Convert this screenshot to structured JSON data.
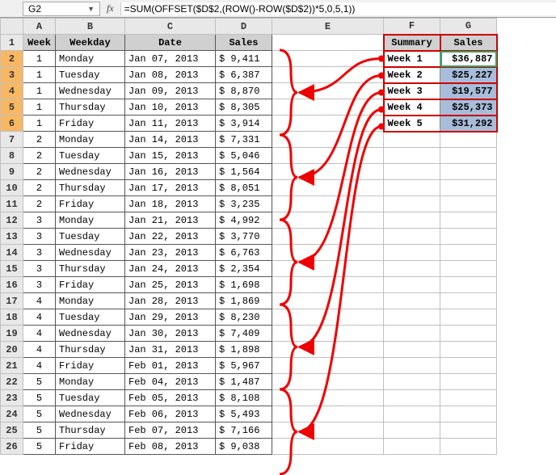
{
  "formula_bar": {
    "cell_ref": "G2",
    "fx_label": "fx",
    "formula": "=SUM(OFFSET($D$2,(ROW()-ROW($D$2))*5,0,5,1))"
  },
  "columns": [
    "A",
    "B",
    "C",
    "D",
    "E",
    "F",
    "G"
  ],
  "main_headers": {
    "A": "Week",
    "B": "Weekday",
    "C": "Date",
    "D": "Sales"
  },
  "summary_headers": {
    "F": "Summary",
    "G": "Sales"
  },
  "rows": [
    {
      "n": 2,
      "wk": "1",
      "wd": "Monday",
      "dt": "Jan 07, 2013",
      "sl": "$ 9,411",
      "sm_lbl": "Week 1",
      "sm_val": "$36,887"
    },
    {
      "n": 3,
      "wk": "1",
      "wd": "Tuesday",
      "dt": "Jan 08, 2013",
      "sl": "$ 6,387",
      "sm_lbl": "Week 2",
      "sm_val": "$25,227"
    },
    {
      "n": 4,
      "wk": "1",
      "wd": "Wednesday",
      "dt": "Jan 09, 2013",
      "sl": "$ 8,870",
      "sm_lbl": "Week 3",
      "sm_val": "$19,577"
    },
    {
      "n": 5,
      "wk": "1",
      "wd": "Thursday",
      "dt": "Jan 10, 2013",
      "sl": "$ 8,305",
      "sm_lbl": "Week 4",
      "sm_val": "$25,373"
    },
    {
      "n": 6,
      "wk": "1",
      "wd": "Friday",
      "dt": "Jan 11, 2013",
      "sl": "$ 3,914",
      "sm_lbl": "Week 5",
      "sm_val": "$31,292"
    },
    {
      "n": 7,
      "wk": "2",
      "wd": "Monday",
      "dt": "Jan 14, 2013",
      "sl": "$ 7,331"
    },
    {
      "n": 8,
      "wk": "2",
      "wd": "Tuesday",
      "dt": "Jan 15, 2013",
      "sl": "$ 5,046"
    },
    {
      "n": 9,
      "wk": "2",
      "wd": "Wednesday",
      "dt": "Jan 16, 2013",
      "sl": "$ 1,564"
    },
    {
      "n": 10,
      "wk": "2",
      "wd": "Thursday",
      "dt": "Jan 17, 2013",
      "sl": "$ 8,051"
    },
    {
      "n": 11,
      "wk": "2",
      "wd": "Friday",
      "dt": "Jan 18, 2013",
      "sl": "$ 3,235"
    },
    {
      "n": 12,
      "wk": "3",
      "wd": "Monday",
      "dt": "Jan 21, 2013",
      "sl": "$ 4,992"
    },
    {
      "n": 13,
      "wk": "3",
      "wd": "Tuesday",
      "dt": "Jan 22, 2013",
      "sl": "$ 3,770"
    },
    {
      "n": 14,
      "wk": "3",
      "wd": "Wednesday",
      "dt": "Jan 23, 2013",
      "sl": "$ 6,763"
    },
    {
      "n": 15,
      "wk": "3",
      "wd": "Thursday",
      "dt": "Jan 24, 2013",
      "sl": "$ 2,354"
    },
    {
      "n": 16,
      "wk": "3",
      "wd": "Friday",
      "dt": "Jan 25, 2013",
      "sl": "$ 1,698"
    },
    {
      "n": 17,
      "wk": "4",
      "wd": "Monday",
      "dt": "Jan 28, 2013",
      "sl": "$ 1,869"
    },
    {
      "n": 18,
      "wk": "4",
      "wd": "Tuesday",
      "dt": "Jan 29, 2013",
      "sl": "$ 8,230"
    },
    {
      "n": 19,
      "wk": "4",
      "wd": "Wednesday",
      "dt": "Jan 30, 2013",
      "sl": "$ 7,409"
    },
    {
      "n": 20,
      "wk": "4",
      "wd": "Thursday",
      "dt": "Jan 31, 2013",
      "sl": "$ 1,898"
    },
    {
      "n": 21,
      "wk": "4",
      "wd": "Friday",
      "dt": "Feb 01, 2013",
      "sl": "$ 5,967"
    },
    {
      "n": 22,
      "wk": "5",
      "wd": "Monday",
      "dt": "Feb 04, 2013",
      "sl": "$ 1,487"
    },
    {
      "n": 23,
      "wk": "5",
      "wd": "Tuesday",
      "dt": "Feb 05, 2013",
      "sl": "$ 8,108"
    },
    {
      "n": 24,
      "wk": "5",
      "wd": "Wednesday",
      "dt": "Feb 06, 2013",
      "sl": "$ 5,493"
    },
    {
      "n": 25,
      "wk": "5",
      "wd": "Thursday",
      "dt": "Feb 07, 2013",
      "sl": "$ 7,166"
    },
    {
      "n": 26,
      "wk": "5",
      "wd": "Friday",
      "dt": "Feb 08, 2013",
      "sl": "$ 9,038"
    }
  ],
  "highlight_rows": [
    2,
    3,
    4,
    5,
    6
  ],
  "chart_data": {
    "type": "table",
    "note": "Weekly sum of daily sales via OFFSET formula",
    "series": [
      {
        "name": "Week 1",
        "values": [
          9411,
          6387,
          8870,
          8305,
          3914
        ],
        "sum": 36887
      },
      {
        "name": "Week 2",
        "values": [
          7331,
          5046,
          1564,
          8051,
          3235
        ],
        "sum": 25227
      },
      {
        "name": "Week 3",
        "values": [
          4992,
          3770,
          6763,
          2354,
          1698
        ],
        "sum": 19577
      },
      {
        "name": "Week 4",
        "values": [
          1869,
          8230,
          7409,
          1898,
          5967
        ],
        "sum": 25373
      },
      {
        "name": "Week 5",
        "values": [
          1487,
          8108,
          5493,
          7166,
          9038
        ],
        "sum": 31292
      }
    ]
  }
}
